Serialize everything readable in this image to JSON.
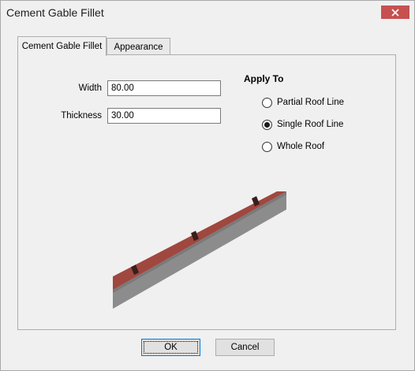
{
  "window": {
    "title": "Cement Gable Fillet",
    "close_icon": "close-icon"
  },
  "tabs": [
    {
      "label": "Cement Gable Fillet",
      "active": true
    },
    {
      "label": "Appearance",
      "active": false
    }
  ],
  "fields": {
    "width_label": "Width",
    "width_value": "80.00",
    "thickness_label": "Thickness",
    "thickness_value": "30.00"
  },
  "apply_to": {
    "title": "Apply To",
    "options": [
      {
        "label": "Partial Roof Line",
        "selected": false
      },
      {
        "label": "Single Roof Line",
        "selected": true
      },
      {
        "label": "Whole Roof",
        "selected": false
      }
    ]
  },
  "buttons": {
    "ok": "OK",
    "cancel": "Cancel"
  },
  "colors": {
    "close_button": "#c75050",
    "fillet_top": "#a0473f",
    "fillet_side": "#8c8c8c",
    "fillet_dark": "#3a1e1b"
  }
}
